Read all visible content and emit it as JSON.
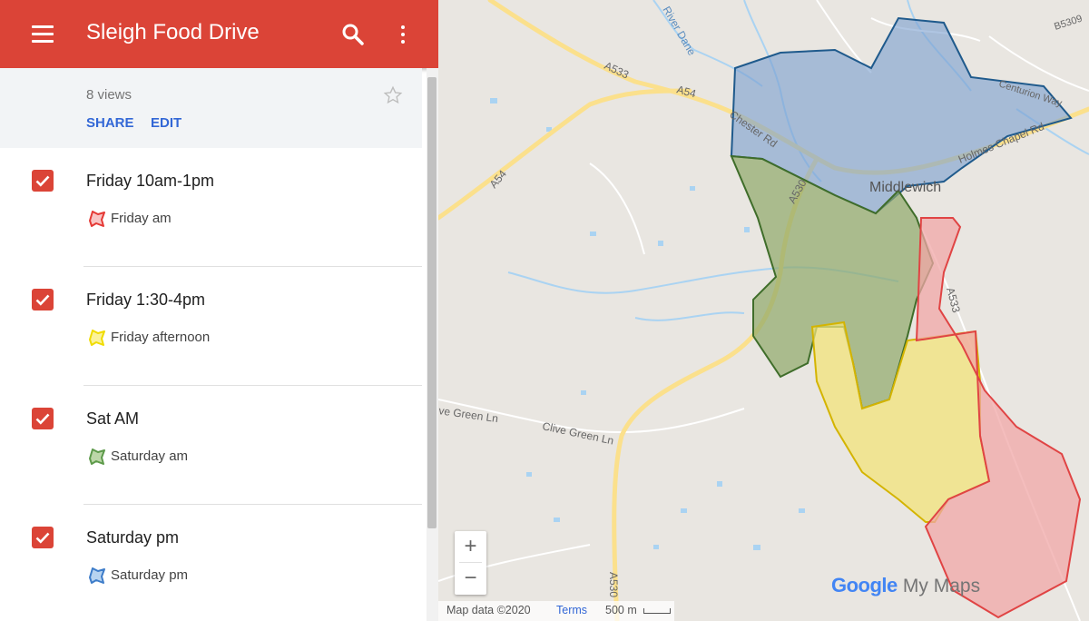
{
  "header": {
    "title": "Sleigh Food Drive",
    "color": "#db4437"
  },
  "info": {
    "views": "8 views",
    "share_label": "SHARE",
    "edit_label": "EDIT"
  },
  "layers": [
    {
      "name": "Friday 10am-1pm",
      "checked": true,
      "feature": "Friday am",
      "color": "#e06666"
    },
    {
      "name": "Friday 1:30-4pm",
      "checked": true,
      "feature": "Friday afternoon",
      "color": "#f4e25c"
    },
    {
      "name": "Sat AM",
      "checked": true,
      "feature": "Saturday am",
      "color": "#7fae68"
    },
    {
      "name": "Saturday pm",
      "checked": true,
      "feature": "Saturday pm",
      "color": "#6fa8dc"
    }
  ],
  "map": {
    "place_label": "Middlewich",
    "road_labels": [
      "A533",
      "A54",
      "A54",
      "A530",
      "A530",
      "A533",
      "Chester Rd",
      "Holmes Chapel Rd",
      "Centurion Way",
      "B5309",
      "River Dane",
      "Clive Green Ln",
      "ve Green Ln"
    ],
    "regions": [
      {
        "name": "Saturday pm",
        "fill": "#7a9fcf",
        "stroke": "#1f5a8c"
      },
      {
        "name": "Saturday am",
        "fill": "#8ea86a",
        "stroke": "#3f6d2a"
      },
      {
        "name": "Friday afternoon",
        "fill": "#f2e37a",
        "stroke": "#d4b400"
      },
      {
        "name": "Friday am",
        "fill": "#f0a7a7",
        "stroke": "#e04444"
      }
    ],
    "zoom_in": "+",
    "zoom_out": "−",
    "attribution": "Map data ©2020",
    "terms": "Terms",
    "scale": "500 m",
    "logo_google": "Google",
    "logo_product": "My Maps"
  }
}
